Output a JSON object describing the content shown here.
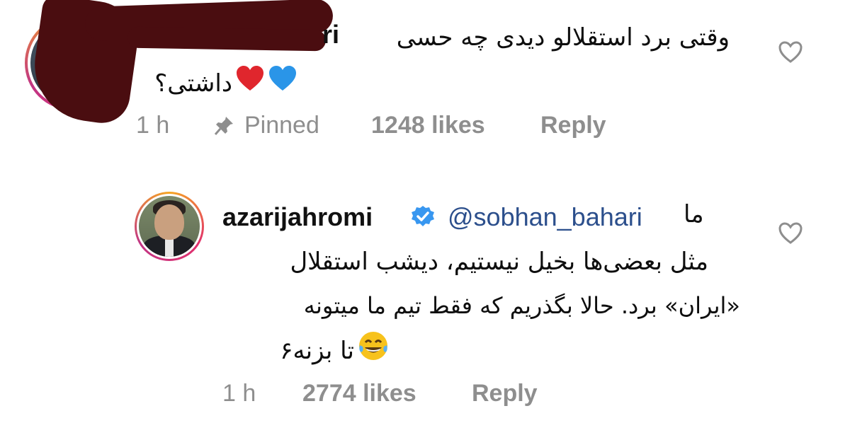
{
  "comment1": {
    "username_visible": "ri",
    "text_line1": "وقتی برد استقلالو دیدی چه حسی",
    "text_line2": "داشتی؟",
    "time": "1 h",
    "pinned_label": "Pinned",
    "likes": "1248 likes",
    "reply_label": "Reply",
    "icons": {
      "pin": "pin-icon",
      "heart": "heart-outline-icon"
    }
  },
  "comment2": {
    "username": "azarijahromi",
    "mention": "@sobhan_bahari",
    "lead_word": "ما",
    "text_line1": "مثل بعضی‌ها بخیل نیستیم، دیشب استقلال",
    "text_line2": "«ایران» برد. حالا بگذریم که فقط تیم ما میتونه",
    "text_line3": "تا بزنه۶",
    "time": "1 h",
    "likes": "2774 likes",
    "reply_label": "Reply",
    "icons": {
      "verified": "verified-badge-icon",
      "heart": "heart-outline-icon",
      "emoji": "tears-of-joy-emoji"
    }
  },
  "colors": {
    "meta_gray": "#8e8e8e",
    "mention_blue": "#2c4f8c",
    "verified_blue": "#3897f0",
    "ring_gradient": [
      "#f6a623",
      "#e1306c",
      "#c13584"
    ]
  }
}
